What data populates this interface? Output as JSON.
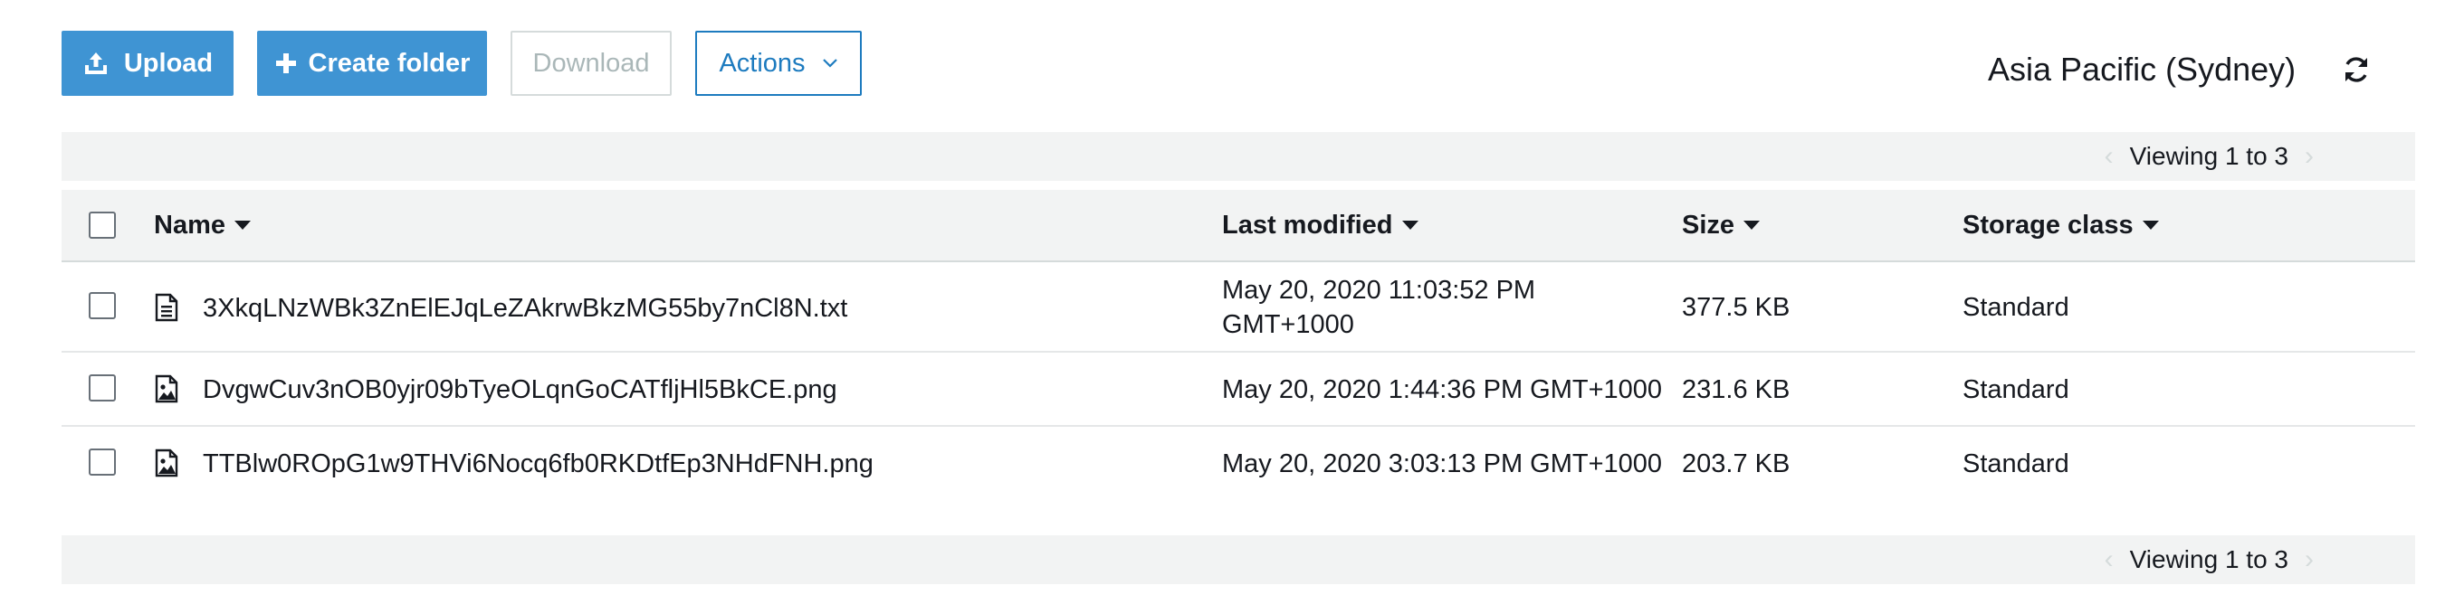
{
  "toolbar": {
    "upload_label": "Upload",
    "create_folder_label": "Create folder",
    "download_label": "Download",
    "actions_label": "Actions"
  },
  "region": "Asia Pacific (Sydney)",
  "pager": {
    "top": "Viewing 1 to 3",
    "bottom": "Viewing 1 to 3"
  },
  "table": {
    "columns": [
      "Name",
      "Last modified",
      "Size",
      "Storage class"
    ],
    "rows": [
      {
        "name": "3XkqLNzWBk3ZnElEJqLeZAkrwBkzMG55by7nCl8N.txt",
        "type_icon": "document-icon",
        "modified_line1": "May 20, 2020 11:03:52 PM",
        "modified_line2": "GMT+1000",
        "size": "377.5 KB",
        "storage_class": "Standard"
      },
      {
        "name": "DvgwCuv3nOB0yjr09bTyeOLqnGoCATfljHl5BkCE.png",
        "type_icon": "image-icon",
        "modified_line1": "May 20, 2020 1:44:36 PM GMT+1000",
        "modified_line2": "",
        "size": "231.6 KB",
        "storage_class": "Standard"
      },
      {
        "name": "TTBlw0ROpG1w9THVi6Nocq6fb0RKDtfEp3NHdFNH.png",
        "type_icon": "image-icon",
        "modified_line1": "May 20, 2020 3:03:13 PM GMT+1000",
        "modified_line2": "",
        "size": "203.7 KB",
        "storage_class": "Standard"
      }
    ]
  },
  "colors": {
    "primary": "#3f94d3",
    "link": "#1d7bbf",
    "header_bg": "#f2f3f3",
    "disabled_text": "#aab7b8"
  }
}
